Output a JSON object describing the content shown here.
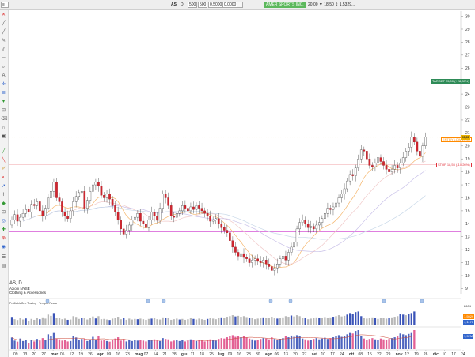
{
  "toolbar": {
    "symbol": "AS",
    "interval": "D",
    "fields": [
      "500",
      "500",
      "0,5000",
      "0,0000"
    ],
    "company_badge": "AMER SPORTS INC.",
    "quote": "20,00  ▼ 18,50  ⇕ 1,5329..."
  },
  "instrument": {
    "title": "AS, D",
    "exchange": "Azioni NYSE",
    "sector": "Clothing & Accessories"
  },
  "indicator_label": "ProfitableOne Trading · Tempus Reata",
  "price_levels": {
    "target": {
      "label": "TARGET 25,00 (+28,89%)",
      "value": 25.0,
      "color": "#2e8b57"
    },
    "entry": {
      "label": "ENTRY LOW 20,50",
      "value": 20.5,
      "color": "#ff8a00"
    },
    "stop": {
      "label": "STOP 18,55 (-10,26%)",
      "value": 18.55,
      "color": "#e0303a"
    },
    "current": {
      "label": "20,67",
      "value": 20.67,
      "color": "#e8b000"
    },
    "support": {
      "value": 13.4,
      "color": "#cc33cc"
    }
  },
  "panels": {
    "lower1_labels": [
      "2604",
      "1,5929",
      "1,1170"
    ],
    "lower2_labels": [
      "1,92M"
    ]
  },
  "chart_data": {
    "type": "candlestick",
    "symbol": "AS",
    "interval": "D",
    "y_ticks": [
      9,
      10,
      11,
      12,
      13,
      14,
      15,
      16,
      17,
      18,
      19,
      20,
      21,
      22,
      23,
      24,
      25,
      26,
      27,
      28,
      29,
      30
    ],
    "ylim": [
      8.6,
      30.4
    ],
    "x_tick_labels": [
      "09",
      "13",
      "20",
      "27",
      "mar",
      "05",
      "12",
      "19",
      "26",
      "apr",
      "09",
      "16",
      "23",
      "mag",
      "07",
      "14",
      "21",
      "28",
      "giu",
      "11",
      "18",
      "25",
      "lug",
      "09",
      "16",
      "23",
      "30",
      "ago",
      "06",
      "13",
      "20",
      "27",
      "set",
      "10",
      "17",
      "24",
      "ott",
      "08",
      "15",
      "22",
      "29",
      "nov",
      "12",
      "19",
      "26",
      "dic",
      "10",
      "17",
      "24"
    ],
    "closes": [
      14.3,
      14.7,
      14.2,
      14.5,
      14.8,
      15.1,
      14.9,
      15.5,
      15.4,
      15.7,
      15.0,
      14.6,
      15.2,
      16.0,
      16.5,
      17.2,
      16.0,
      15.7,
      14.9,
      14.6,
      14.4,
      15.0,
      15.7,
      16.1,
      16.4,
      16.5,
      15.2,
      15.8,
      16.5,
      17.0,
      17.2,
      16.9,
      16.2,
      16.0,
      16.3,
      15.9,
      15.4,
      14.9,
      14.3,
      13.6,
      13.2,
      13.5,
      13.9,
      14.3,
      14.5,
      14.8,
      14.2,
      14.0,
      13.7,
      14.3,
      14.9,
      14.6,
      14.3,
      15.2,
      16.3,
      16.0,
      15.4,
      14.6,
      14.5,
      14.8,
      15.0,
      15.4,
      15.2,
      15.0,
      15.3,
      15.1,
      15.4,
      15.2,
      15.0,
      14.8,
      14.6,
      14.2,
      14.3,
      14.4,
      14.0,
      13.7,
      13.5,
      13.3,
      12.7,
      12.2,
      11.8,
      11.5,
      11.7,
      11.4,
      11.3,
      11.0,
      11.2,
      11.3,
      11.1,
      11.0,
      11.2,
      10.9,
      10.7,
      10.4,
      10.6,
      10.9,
      11.3,
      11.5,
      11.2,
      11.8,
      12.2,
      12.6,
      13.6,
      14.1,
      14.3,
      14.0,
      13.7,
      13.8,
      13.6,
      13.9,
      14.1,
      14.4,
      14.8,
      15.2,
      15.1,
      15.3,
      15.6,
      16.0,
      16.3,
      16.7,
      17.3,
      17.8,
      17.7,
      18.3,
      19.0,
      19.7,
      19.6,
      19.0,
      18.5,
      18.4,
      18.7,
      19.1,
      18.8,
      18.5,
      18.2,
      18.0,
      18.2,
      18.5,
      18.3,
      18.7,
      19.1,
      19.6,
      19.9,
      20.7,
      20.3,
      19.6,
      19.2,
      20.0,
      20.7
    ],
    "volumes": [
      55,
      40,
      35,
      50,
      38,
      45,
      30,
      42,
      36,
      48,
      40,
      52,
      44,
      70,
      62,
      80,
      50,
      46,
      40,
      44,
      36,
      38,
      60,
      55,
      42,
      48,
      50,
      38,
      46,
      58,
      45,
      60,
      40,
      42,
      38,
      35,
      44,
      50,
      56,
      40,
      48,
      36,
      44,
      38,
      42,
      40,
      44,
      40,
      36,
      42,
      44,
      46,
      40,
      38,
      52,
      48,
      46,
      36,
      40,
      44,
      38,
      42,
      36,
      40,
      46,
      42,
      38,
      44,
      40,
      36,
      42,
      46,
      44,
      40,
      48,
      52,
      50,
      56,
      60,
      66,
      58,
      62,
      56,
      60,
      54,
      50,
      46,
      40,
      44,
      48,
      52,
      50,
      46,
      56,
      48,
      44,
      48,
      52,
      60,
      56,
      64,
      58,
      66,
      60,
      50,
      46,
      40,
      44,
      48,
      52,
      46,
      50,
      54,
      48,
      52,
      56,
      60,
      66,
      58,
      62,
      70,
      80,
      74,
      86,
      90,
      60,
      50,
      44,
      48,
      52,
      46,
      42,
      50,
      46,
      44,
      48,
      52,
      56,
      60,
      74,
      70,
      66,
      72,
      80,
      90
    ]
  }
}
